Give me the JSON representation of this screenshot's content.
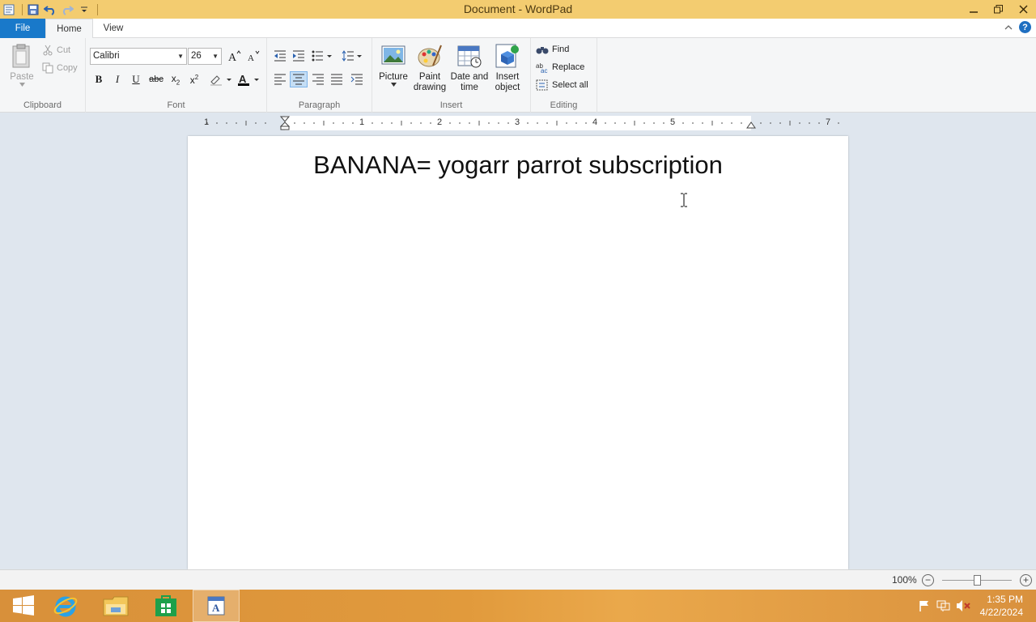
{
  "window": {
    "title": "Document - WordPad"
  },
  "tabs": {
    "file": "File",
    "home": "Home",
    "view": "View"
  },
  "ribbon": {
    "clipboard": {
      "label": "Clipboard",
      "paste": "Paste",
      "cut": "Cut",
      "copy": "Copy"
    },
    "font": {
      "label": "Font",
      "family": "Calibri",
      "size": "26"
    },
    "paragraph": {
      "label": "Paragraph"
    },
    "insert": {
      "label": "Insert",
      "picture": "Picture",
      "paint_line1": "Paint",
      "paint_line2": "drawing",
      "datetime_line1": "Date and",
      "datetime_line2": "time",
      "object_line1": "Insert",
      "object_line2": "object"
    },
    "editing": {
      "label": "Editing",
      "find": "Find",
      "replace": "Replace",
      "select_all": "Select all"
    }
  },
  "ruler": {
    "numbers": [
      "1",
      "1",
      "2",
      "3",
      "4",
      "5",
      "7"
    ]
  },
  "document": {
    "text": "BANANA= yogarr parrot subscription"
  },
  "statusbar": {
    "zoom": "100%"
  },
  "taskbar": {
    "time": "1:35 PM",
    "date": "4/22/2024"
  }
}
